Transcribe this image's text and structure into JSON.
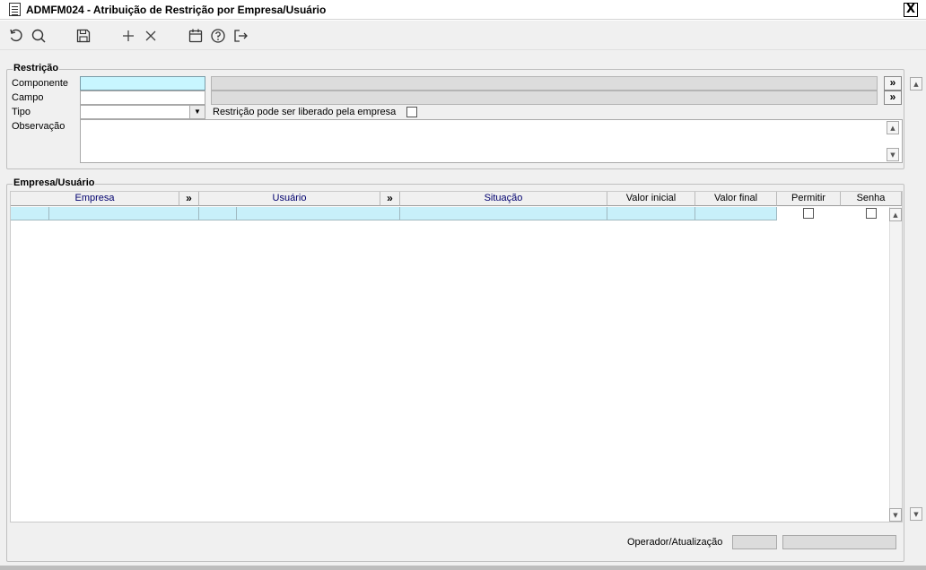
{
  "window": {
    "title": "ADMFM024 - Atribuição de Restrição por Empresa/Usuário",
    "close_label": "X"
  },
  "toolbar": {
    "buttons": [
      {
        "name": "refresh",
        "icon": "refresh-icon"
      },
      {
        "name": "search",
        "icon": "search-icon"
      },
      {
        "name": "save",
        "icon": "save-icon"
      },
      {
        "name": "add",
        "icon": "plus-icon"
      },
      {
        "name": "delete",
        "icon": "close-icon"
      },
      {
        "name": "calendar",
        "icon": "calendar-icon"
      },
      {
        "name": "help",
        "icon": "help-icon"
      },
      {
        "name": "exit",
        "icon": "exit-icon"
      }
    ]
  },
  "restricao": {
    "legend": "Restrição",
    "componente_label": "Componente",
    "componente_value": "",
    "componente_desc": "",
    "campo_label": "Campo",
    "campo_value": "",
    "campo_desc": "",
    "tipo_label": "Tipo",
    "tipo_value": "",
    "liberado_label": "Restrição pode ser liberado pela empresa",
    "liberado_checked": false,
    "observacao_label": "Observação",
    "observacao_value": "",
    "lookup_label": "»"
  },
  "empresa_usuario": {
    "legend": "Empresa/Usuário",
    "columns": {
      "empresa": "Empresa",
      "lookup1": "»",
      "usuario": "Usuário",
      "lookup2": "»",
      "situacao": "Situação",
      "valor_inicial": "Valor inicial",
      "valor_final": "Valor final",
      "permitir": "Permitir",
      "senha": "Senha"
    },
    "rows": [
      {
        "empresa_cod": "",
        "empresa_nome": "",
        "usuario_cod": "",
        "usuario_nome": "",
        "situacao": "",
        "valor_inicial": "",
        "valor_final": "",
        "permitir": false,
        "senha": false
      }
    ]
  },
  "footer": {
    "operador_label": "Operador/Atualização",
    "operador_value": "",
    "atualizacao_value": ""
  },
  "colors": {
    "key_field": "#c8f6ff",
    "readonly_field": "#dcdcdc",
    "header_key_text": "#00006e",
    "window_bg": "#f0f0f0"
  }
}
